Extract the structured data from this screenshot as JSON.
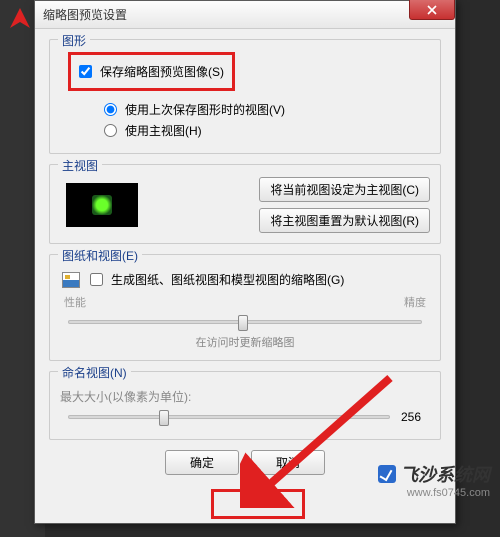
{
  "title": "缩略图预览设置",
  "groups": {
    "drawing": {
      "legend": "图形",
      "save_preview": "保存缩略图预览图像(S)",
      "use_last_view": "使用上次保存图形时的视图(V)",
      "use_home_view": "使用主视图(H)"
    },
    "home": {
      "legend": "主视图",
      "set_current_btn": "将当前视图设定为主视图(C)",
      "reset_default_btn": "将主视图重置为默认视图(R)"
    },
    "sheets": {
      "legend": "图纸和视图(E)",
      "generate": "生成图纸、图纸视图和模型视图的缩略图(G)",
      "perf_label": "性能",
      "precision_label": "精度",
      "update_label": "在访问时更新缩略图"
    },
    "named": {
      "legend": "命名视图(N)",
      "max_size_label": "最大大小(以像素为单位):",
      "max_size_value": "256"
    }
  },
  "buttons": {
    "ok": "确定",
    "cancel": "取消"
  },
  "watermark": {
    "title": "飞沙系统网",
    "url": "www.fs0745.com"
  }
}
